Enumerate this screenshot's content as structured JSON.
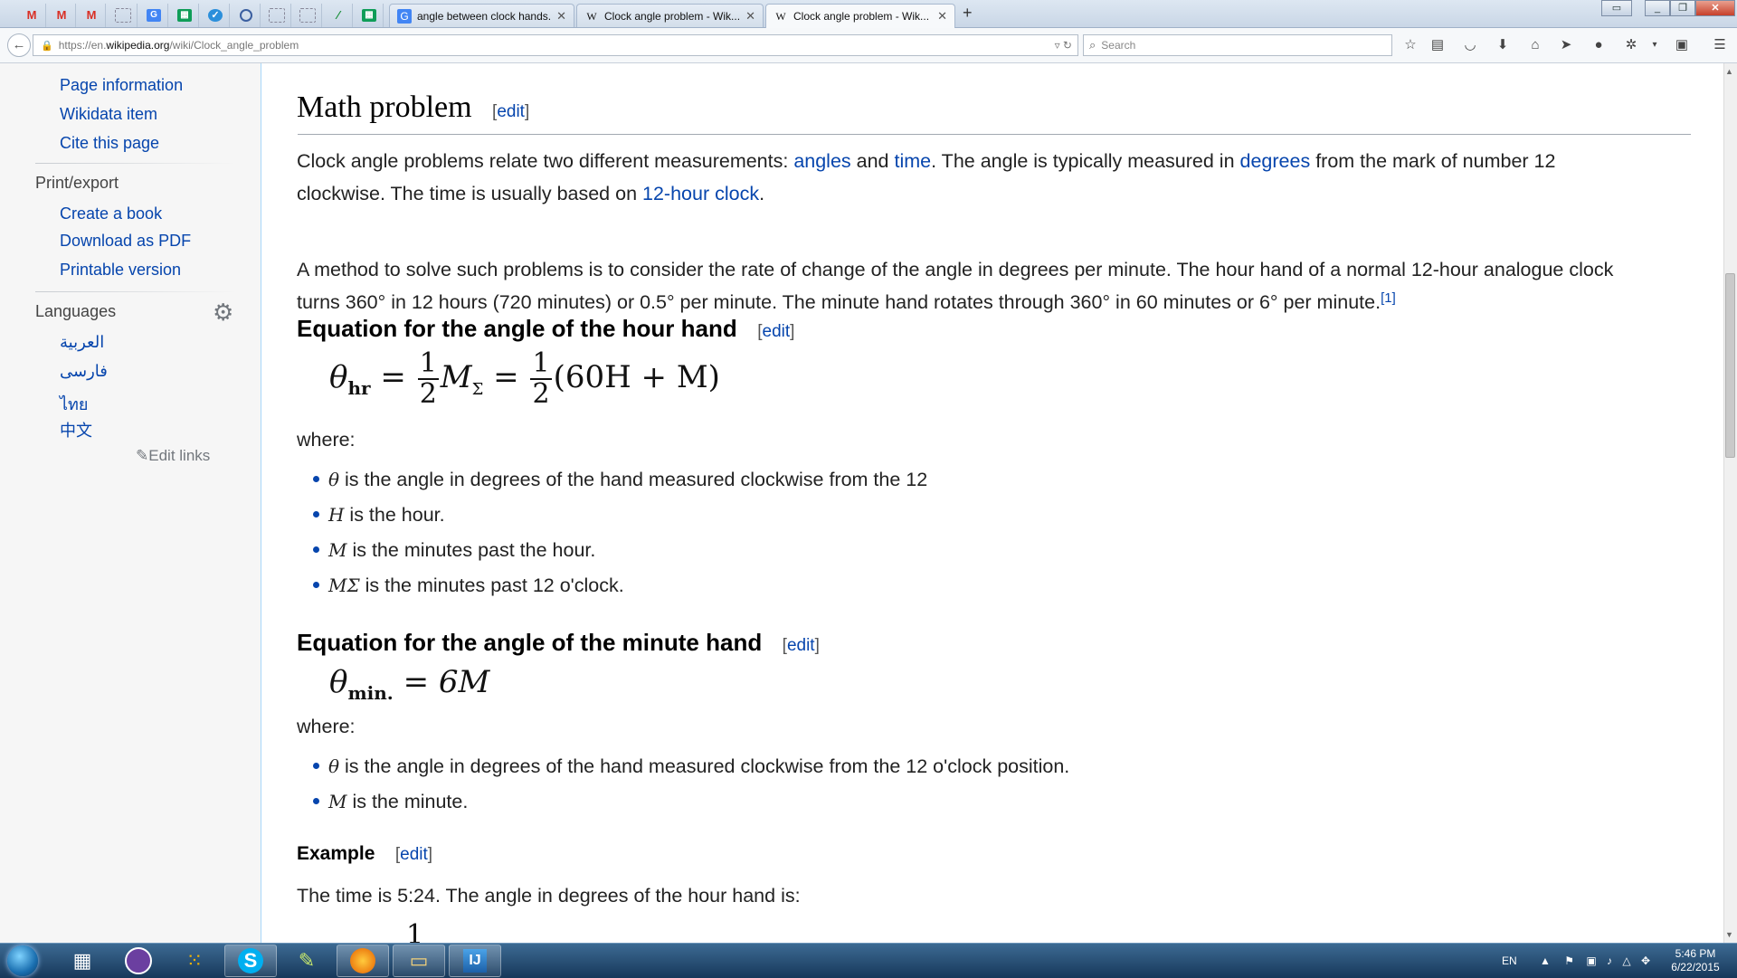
{
  "browser": {
    "tabs": [
      {
        "label": "angle between clock hands...",
        "favicon": "G"
      },
      {
        "label": "Clock angle problem - Wik...",
        "favicon": "W"
      },
      {
        "label": "Clock angle problem - Wik...",
        "favicon": "W",
        "active": true
      }
    ],
    "new_tab": "+",
    "url": {
      "scheme": "https://en.",
      "domain": "wikipedia.org",
      "path": "/wiki/Clock_angle_problem"
    },
    "search_placeholder": "Search"
  },
  "sidebar": {
    "tools_links": [
      "Page information",
      "Wikidata item",
      "Cite this page"
    ],
    "print_heading": "Print/export",
    "print_links": [
      "Create a book",
      "Download as PDF",
      "Printable version"
    ],
    "languages_heading": "Languages",
    "languages": [
      "العربية",
      "فارسی",
      "ไทย",
      "中文"
    ],
    "edit_links": "Edit links"
  },
  "article": {
    "edit_label": "edit",
    "h2": "Math problem",
    "p1": {
      "t1": "Clock angle problems relate two different measurements: ",
      "l1": "angles",
      "t2": " and ",
      "l2": "time",
      "t3": ". The angle is typically measured in ",
      "l3": "degrees",
      "t4": " from the mark of number 12",
      "t5": "clockwise. The time is usually based on ",
      "l4": "12-hour clock",
      "t6": "."
    },
    "p2": {
      "line1": "A method to solve such problems is to consider the rate of change of the angle in degrees per minute. The hour hand of a normal 12-hour analogue clock",
      "line2": "turns 360° in 12 hours (720 minutes) or 0.5° per minute. The minute hand rotates through 360° in 60 minutes or 6° per minute.",
      "ref": "[1]"
    },
    "h3_hour": "Equation for the angle of the hour hand",
    "h3_minute": "Equation for the angle of the minute hand",
    "where": "where:",
    "hour_list": [
      {
        "sym": "θ",
        "text": " is the angle in degrees of the hand measured clockwise from the 12"
      },
      {
        "sym": "H",
        "text": " is the hour."
      },
      {
        "sym": "M",
        "text": " is the minutes past the hour."
      },
      {
        "sym": "MΣ",
        "text": " is the minutes past 12 o'clock."
      }
    ],
    "minute_list": [
      {
        "sym": "θ",
        "text": " is the angle in degrees of the hand measured clockwise from the 12 o'clock position."
      },
      {
        "sym": "M",
        "text": " is the minute."
      }
    ],
    "h4_example": "Example",
    "example_text": "The time is 5:24. The angle in degrees of the hour hand is:",
    "eq_hour": {
      "theta": "θ",
      "sub": "hr",
      "one": "1",
      "two": "2",
      "msigma": "M",
      "sigma": "Σ",
      "rest": "(60H + M)"
    },
    "eq_minute": {
      "theta": "θ",
      "sub": "min.",
      "rhs": "= 6M"
    },
    "eq_cut": "1"
  },
  "taskbar": {
    "lang": "EN",
    "time": "5:46 PM",
    "date": "6/22/2015"
  },
  "colors": {
    "link": "#0645ad",
    "sidebar_bg": "#f6f6f6",
    "taskbar": "#1f4a73"
  }
}
